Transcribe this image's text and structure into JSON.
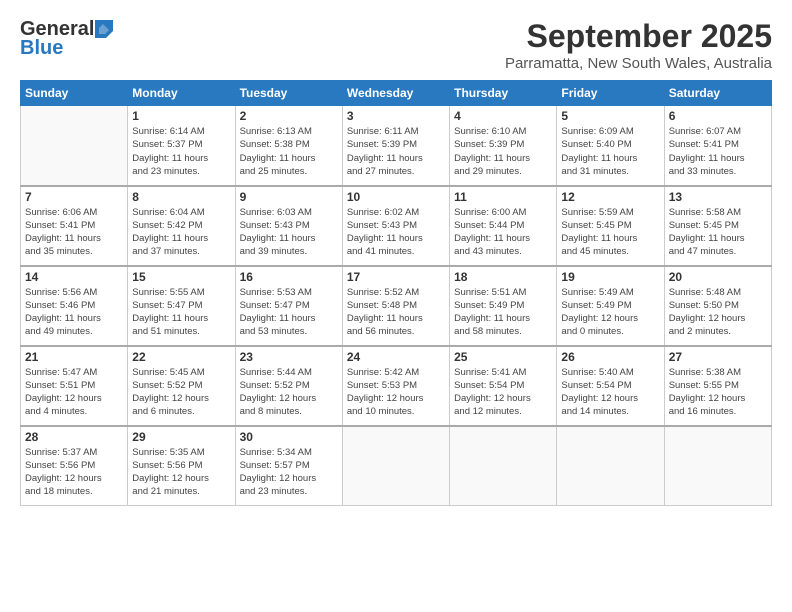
{
  "header": {
    "logo_general": "General",
    "logo_blue": "Blue",
    "month_title": "September 2025",
    "location": "Parramatta, New South Wales, Australia"
  },
  "days_of_week": [
    "Sunday",
    "Monday",
    "Tuesday",
    "Wednesday",
    "Thursday",
    "Friday",
    "Saturday"
  ],
  "weeks": [
    [
      {
        "day": "",
        "info": ""
      },
      {
        "day": "1",
        "info": "Sunrise: 6:14 AM\nSunset: 5:37 PM\nDaylight: 11 hours\nand 23 minutes."
      },
      {
        "day": "2",
        "info": "Sunrise: 6:13 AM\nSunset: 5:38 PM\nDaylight: 11 hours\nand 25 minutes."
      },
      {
        "day": "3",
        "info": "Sunrise: 6:11 AM\nSunset: 5:39 PM\nDaylight: 11 hours\nand 27 minutes."
      },
      {
        "day": "4",
        "info": "Sunrise: 6:10 AM\nSunset: 5:39 PM\nDaylight: 11 hours\nand 29 minutes."
      },
      {
        "day": "5",
        "info": "Sunrise: 6:09 AM\nSunset: 5:40 PM\nDaylight: 11 hours\nand 31 minutes."
      },
      {
        "day": "6",
        "info": "Sunrise: 6:07 AM\nSunset: 5:41 PM\nDaylight: 11 hours\nand 33 minutes."
      }
    ],
    [
      {
        "day": "7",
        "info": "Sunrise: 6:06 AM\nSunset: 5:41 PM\nDaylight: 11 hours\nand 35 minutes."
      },
      {
        "day": "8",
        "info": "Sunrise: 6:04 AM\nSunset: 5:42 PM\nDaylight: 11 hours\nand 37 minutes."
      },
      {
        "day": "9",
        "info": "Sunrise: 6:03 AM\nSunset: 5:43 PM\nDaylight: 11 hours\nand 39 minutes."
      },
      {
        "day": "10",
        "info": "Sunrise: 6:02 AM\nSunset: 5:43 PM\nDaylight: 11 hours\nand 41 minutes."
      },
      {
        "day": "11",
        "info": "Sunrise: 6:00 AM\nSunset: 5:44 PM\nDaylight: 11 hours\nand 43 minutes."
      },
      {
        "day": "12",
        "info": "Sunrise: 5:59 AM\nSunset: 5:45 PM\nDaylight: 11 hours\nand 45 minutes."
      },
      {
        "day": "13",
        "info": "Sunrise: 5:58 AM\nSunset: 5:45 PM\nDaylight: 11 hours\nand 47 minutes."
      }
    ],
    [
      {
        "day": "14",
        "info": "Sunrise: 5:56 AM\nSunset: 5:46 PM\nDaylight: 11 hours\nand 49 minutes."
      },
      {
        "day": "15",
        "info": "Sunrise: 5:55 AM\nSunset: 5:47 PM\nDaylight: 11 hours\nand 51 minutes."
      },
      {
        "day": "16",
        "info": "Sunrise: 5:53 AM\nSunset: 5:47 PM\nDaylight: 11 hours\nand 53 minutes."
      },
      {
        "day": "17",
        "info": "Sunrise: 5:52 AM\nSunset: 5:48 PM\nDaylight: 11 hours\nand 56 minutes."
      },
      {
        "day": "18",
        "info": "Sunrise: 5:51 AM\nSunset: 5:49 PM\nDaylight: 11 hours\nand 58 minutes."
      },
      {
        "day": "19",
        "info": "Sunrise: 5:49 AM\nSunset: 5:49 PM\nDaylight: 12 hours\nand 0 minutes."
      },
      {
        "day": "20",
        "info": "Sunrise: 5:48 AM\nSunset: 5:50 PM\nDaylight: 12 hours\nand 2 minutes."
      }
    ],
    [
      {
        "day": "21",
        "info": "Sunrise: 5:47 AM\nSunset: 5:51 PM\nDaylight: 12 hours\nand 4 minutes."
      },
      {
        "day": "22",
        "info": "Sunrise: 5:45 AM\nSunset: 5:52 PM\nDaylight: 12 hours\nand 6 minutes."
      },
      {
        "day": "23",
        "info": "Sunrise: 5:44 AM\nSunset: 5:52 PM\nDaylight: 12 hours\nand 8 minutes."
      },
      {
        "day": "24",
        "info": "Sunrise: 5:42 AM\nSunset: 5:53 PM\nDaylight: 12 hours\nand 10 minutes."
      },
      {
        "day": "25",
        "info": "Sunrise: 5:41 AM\nSunset: 5:54 PM\nDaylight: 12 hours\nand 12 minutes."
      },
      {
        "day": "26",
        "info": "Sunrise: 5:40 AM\nSunset: 5:54 PM\nDaylight: 12 hours\nand 14 minutes."
      },
      {
        "day": "27",
        "info": "Sunrise: 5:38 AM\nSunset: 5:55 PM\nDaylight: 12 hours\nand 16 minutes."
      }
    ],
    [
      {
        "day": "28",
        "info": "Sunrise: 5:37 AM\nSunset: 5:56 PM\nDaylight: 12 hours\nand 18 minutes."
      },
      {
        "day": "29",
        "info": "Sunrise: 5:35 AM\nSunset: 5:56 PM\nDaylight: 12 hours\nand 21 minutes."
      },
      {
        "day": "30",
        "info": "Sunrise: 5:34 AM\nSunset: 5:57 PM\nDaylight: 12 hours\nand 23 minutes."
      },
      {
        "day": "",
        "info": ""
      },
      {
        "day": "",
        "info": ""
      },
      {
        "day": "",
        "info": ""
      },
      {
        "day": "",
        "info": ""
      }
    ]
  ]
}
